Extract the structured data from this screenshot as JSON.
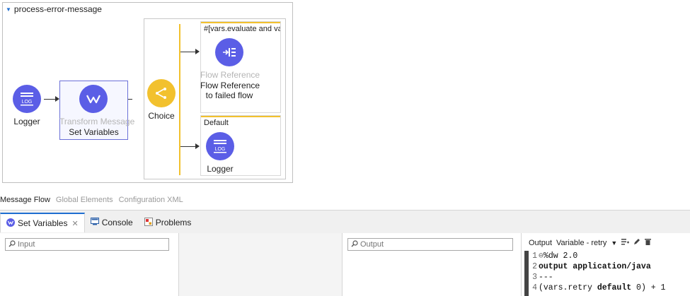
{
  "flow": {
    "title": "process-error-message",
    "nodes": {
      "logger1": {
        "icon": "logger-icon",
        "label": "Logger",
        "icon_text": "LOG"
      },
      "transform": {
        "icon": "transform-icon",
        "sub": "Transform Message",
        "label": "Set Variables"
      },
      "choice": {
        "icon": "choice-icon",
        "label": "Choice"
      },
      "flowref": {
        "icon": "flow-reference-icon",
        "sub": "Flow Reference",
        "label1": "Flow Reference",
        "label2": "to failed flow"
      },
      "logger2": {
        "icon": "logger-icon",
        "label": "Logger",
        "icon_text": "LOG"
      }
    },
    "routes": {
      "when": "#[vars.evaluate and va...",
      "default": "Default"
    }
  },
  "editor_tabs": [
    "Message Flow",
    "Global Elements",
    "Configuration XML"
  ],
  "panel": {
    "tabs": [
      {
        "label": "Set Variables",
        "icon": "set-variables-icon"
      },
      {
        "label": "Console",
        "icon": "console-icon"
      },
      {
        "label": "Problems",
        "icon": "problems-icon"
      }
    ],
    "input_placeholder": "Input",
    "output_placeholder": "Output",
    "output_label": "Output",
    "output_target": "Variable - retry",
    "code": {
      "l1": {
        "num": "1",
        "fold": "⊖",
        "text": "%dw 2.0"
      },
      "l2": {
        "num": "2",
        "kw": "output application/java"
      },
      "l3": {
        "num": "3",
        "text": "---"
      },
      "l4": {
        "num": "4",
        "a": "(vars.retry ",
        "kw": "default",
        "b": " 0) + 1"
      }
    }
  },
  "colors": {
    "node_blue": "#5b5ee6",
    "choice_gold": "#f2c12e",
    "accent": "#1f6fd1"
  }
}
